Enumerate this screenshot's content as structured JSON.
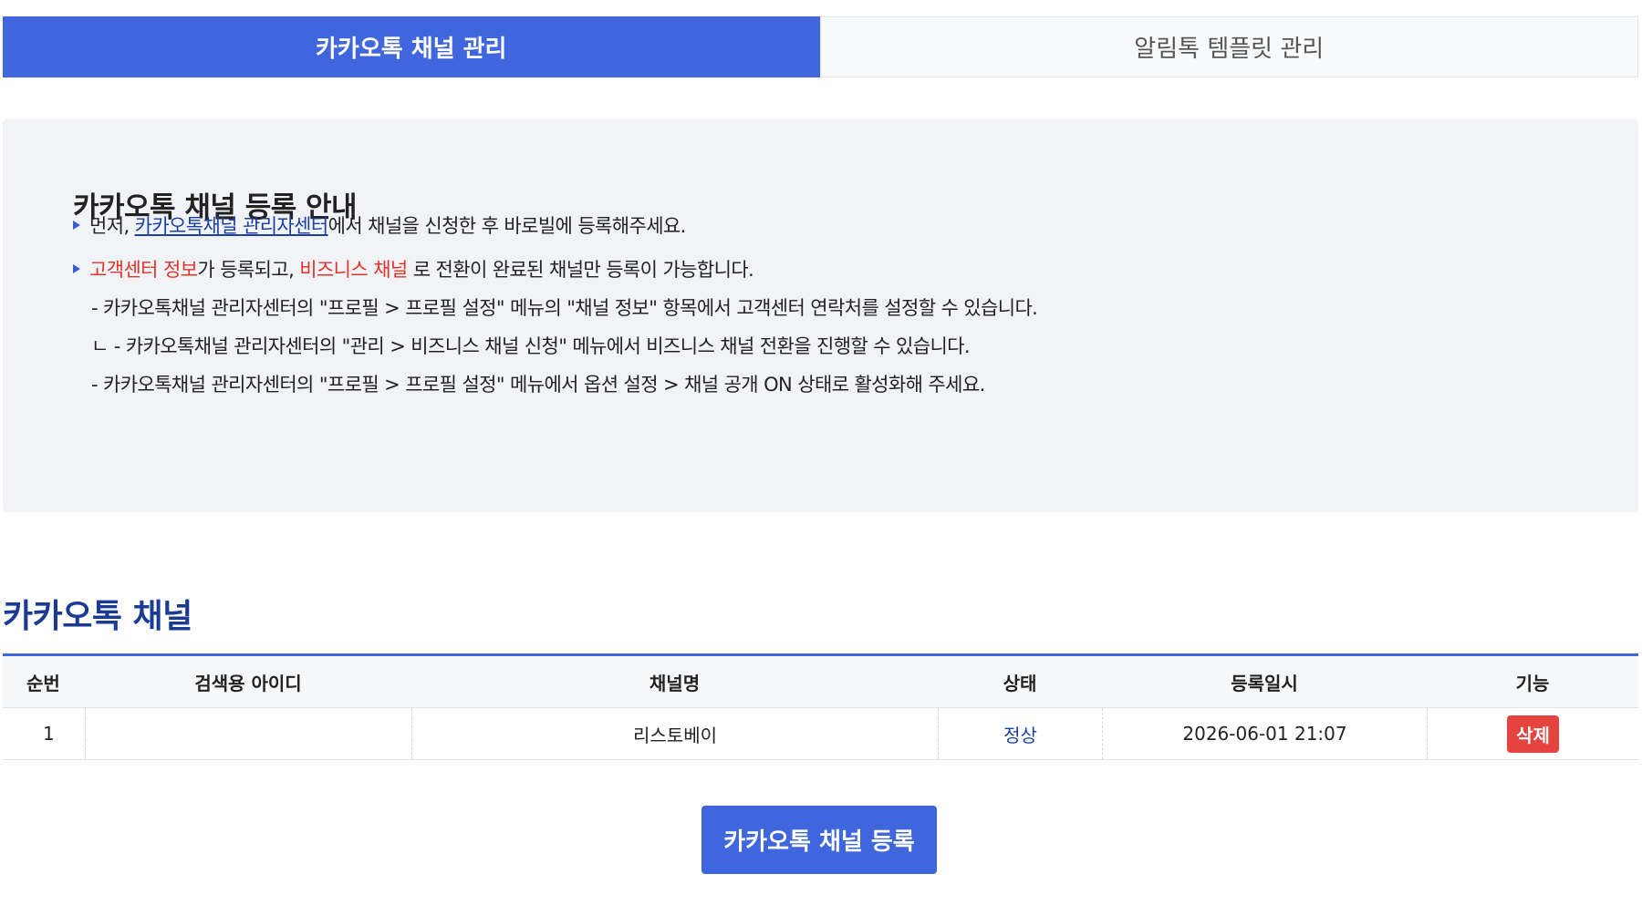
{
  "tabs": [
    {
      "label": "카카오톡 채널 관리",
      "active": true
    },
    {
      "label": "알림톡 템플릿 관리",
      "active": false
    }
  ],
  "info": {
    "title": "카카오톡 채널 등록 안내",
    "line1": {
      "prefix": "먼저, ",
      "link": "카카오톡채널 관리자센터",
      "suffix": "에서 채널을 신청한 후 바로빌에 등록해주세요."
    },
    "line2": {
      "red1": "고객센터 정보",
      "mid": "가 등록되고, ",
      "red2": "비즈니스 채널",
      "suffix": " 로 전환이 완료된 채널만 등록이 가능합니다."
    },
    "sub1": "- 카카오톡채널 관리자센터의 \"프로필 > 프로필 설정\" 메뉴의 \"채널 정보\" 항목에서 고객센터 연락처를 설정할 수 있습니다.",
    "sub2": "ㄴ - 카카오톡채널 관리자센터의 \"관리 > 비즈니스 채널 신청\" 메뉴에서 비즈니스 채널 전환을 진행할 수 있습니다.",
    "sub3": "- 카카오톡채널 관리자센터의 \"프로필 > 프로필 설정\" 메뉴에서 옵션 설정 > 채널 공개 ON 상태로 활성화해 주세요."
  },
  "section_title": "카카오톡 채널",
  "table": {
    "headers": [
      "순번",
      "검색용 아이디",
      "채널명",
      "상태",
      "등록일시",
      "기능"
    ],
    "rows": [
      {
        "no": "1",
        "search_id": "",
        "channel": "리스토베이",
        "status": "정상",
        "date": "2026-06-01 21:07",
        "action": "삭제"
      }
    ]
  },
  "register_label": "카카오톡 채널 등록",
  "colors": {
    "accent": "#3f66dc",
    "danger": "#e5433d",
    "link": "#1b3fa8"
  }
}
